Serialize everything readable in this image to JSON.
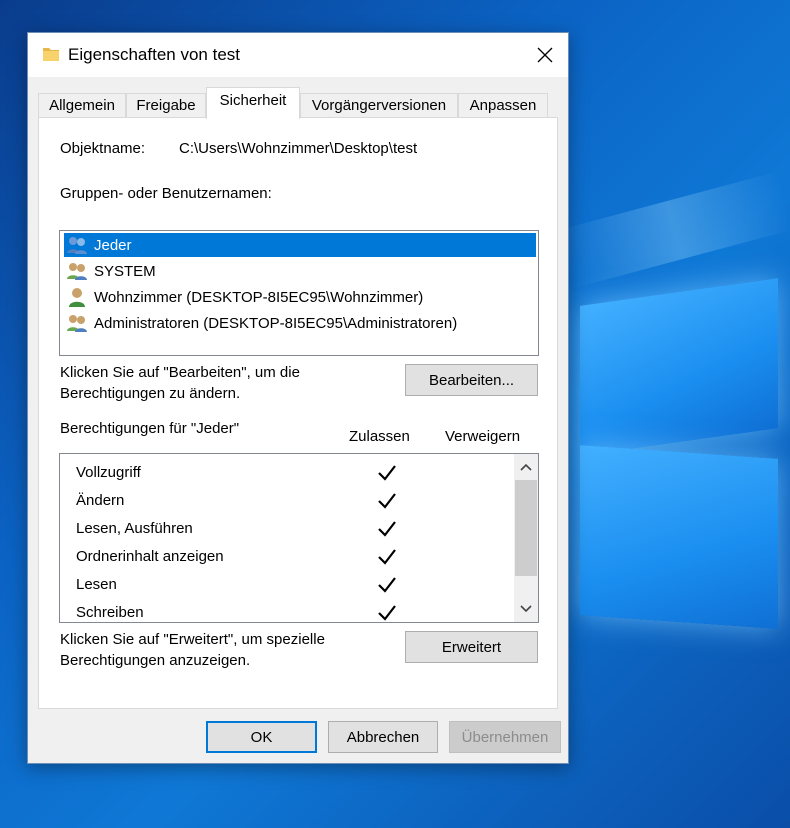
{
  "window": {
    "title": "Eigenschaften von test"
  },
  "tabs": [
    {
      "label": "Allgemein",
      "active": false
    },
    {
      "label": "Freigabe",
      "active": false
    },
    {
      "label": "Sicherheit",
      "active": true
    },
    {
      "label": "Vorgängerversionen",
      "active": false
    },
    {
      "label": "Anpassen",
      "active": false
    }
  ],
  "security": {
    "object_label": "Objektname:",
    "object_value": "C:\\Users\\Wohnzimmer\\Desktop\\test",
    "groups_label": "Gruppen- oder Benutzernamen:",
    "groups": [
      {
        "label": "Jeder",
        "icon": "users-icon",
        "selected": true
      },
      {
        "label": "SYSTEM",
        "icon": "users-icon",
        "selected": false
      },
      {
        "label": "Wohnzimmer (DESKTOP-8I5EC95\\Wohnzimmer)",
        "icon": "user-icon",
        "selected": false
      },
      {
        "label": "Administratoren (DESKTOP-8I5EC95\\Administratoren)",
        "icon": "users-icon",
        "selected": false
      }
    ],
    "edit_hint": "Klicken Sie auf \"Bearbeiten\", um die Berechtigungen zu ändern.",
    "edit_hint_line1": "Klicken Sie auf \"Bearbeiten\", um die",
    "edit_hint_line2": "Berechtigungen zu ändern.",
    "edit_button": "Bearbeiten...",
    "permissions_label": "Berechtigungen für \"Jeder\"",
    "col_allow": "Zulassen",
    "col_deny": "Verweigern",
    "permissions": [
      {
        "name": "Vollzugriff",
        "allow": true,
        "deny": false
      },
      {
        "name": "Ändern",
        "allow": true,
        "deny": false
      },
      {
        "name": "Lesen, Ausführen",
        "allow": true,
        "deny": false
      },
      {
        "name": "Ordnerinhalt anzeigen",
        "allow": true,
        "deny": false
      },
      {
        "name": "Lesen",
        "allow": true,
        "deny": false
      },
      {
        "name": "Schreiben",
        "allow": true,
        "deny": false
      }
    ],
    "advanced_hint_line1": "Klicken Sie auf \"Erweitert\", um spezielle",
    "advanced_hint_line2": "Berechtigungen anzuzeigen.",
    "advanced_button": "Erweitert"
  },
  "footer": {
    "ok": "OK",
    "cancel": "Abbrechen",
    "apply": "Übernehmen"
  },
  "colors": {
    "selection": "#0078d7",
    "desktop": "#0b63c4"
  }
}
